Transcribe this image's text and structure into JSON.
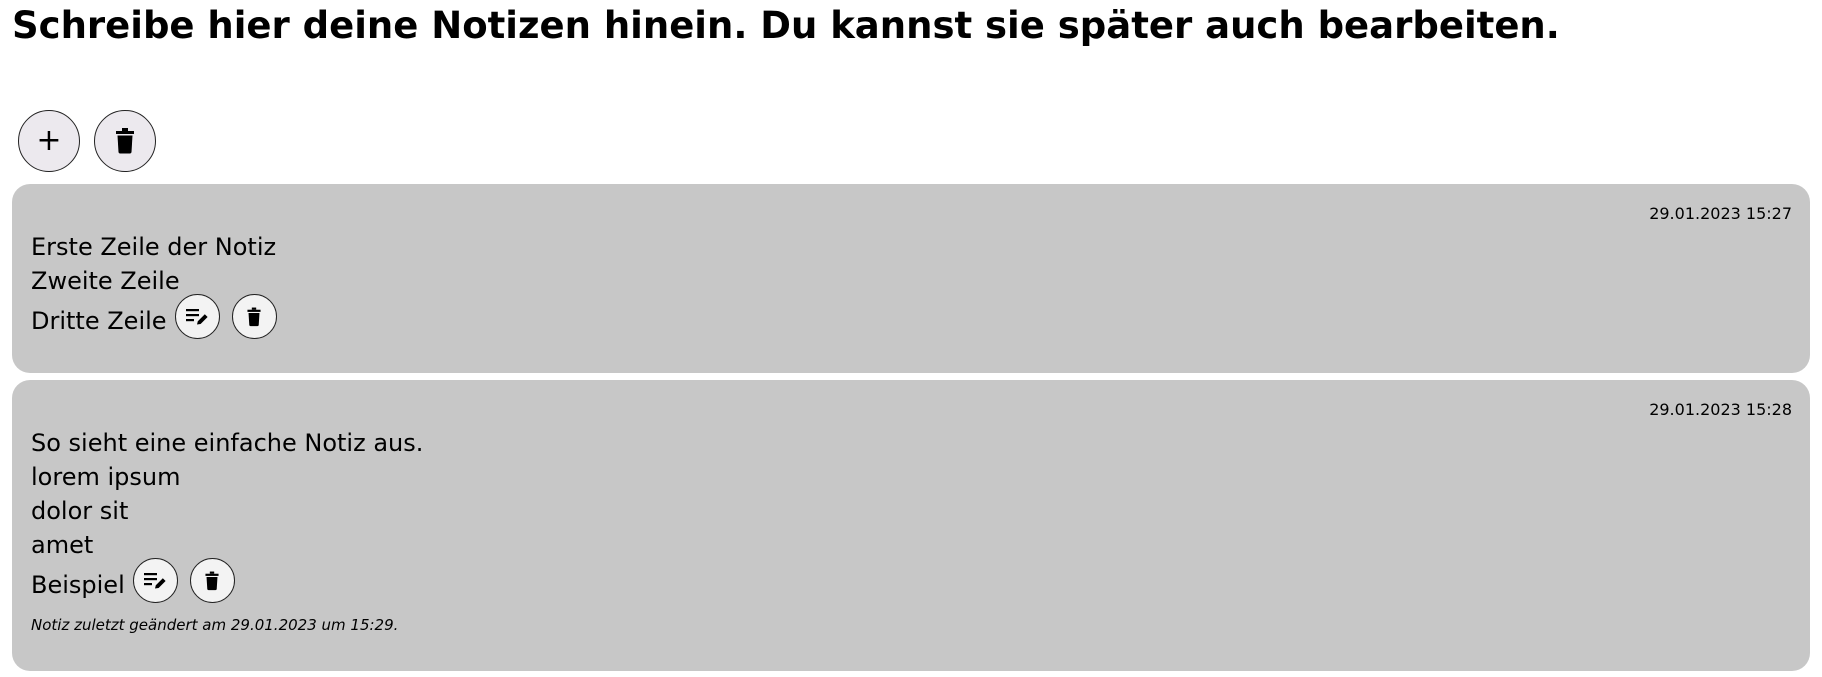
{
  "header": {
    "title": "Schreibe hier deine Notizen hinein. Du kannst sie später auch bearbeiten."
  },
  "toolbar": {
    "add_icon": "plus-icon",
    "add_symbol": "+",
    "delete_all_icon": "trash-icon"
  },
  "notes": [
    {
      "date": "29.01.2023 15:27",
      "lines": [
        "Erste Zeile der Notiz",
        "Zweite Zeile",
        "Dritte Zeile"
      ],
      "edit_icon": "edit-note-icon",
      "delete_icon": "trash-icon",
      "footer": ""
    },
    {
      "date": "29.01.2023 15:28",
      "lines": [
        "So sieht eine einfache Notiz aus.",
        "lorem ipsum",
        "dolor sit",
        "amet",
        "Beispiel"
      ],
      "edit_icon": "edit-note-icon",
      "delete_icon": "trash-icon",
      "footer": "Notiz zuletzt geändert am 29.01.2023 um 15:29."
    }
  ],
  "colors": {
    "note_background": "#c7c7c7",
    "button_background": "#ece9ee"
  }
}
